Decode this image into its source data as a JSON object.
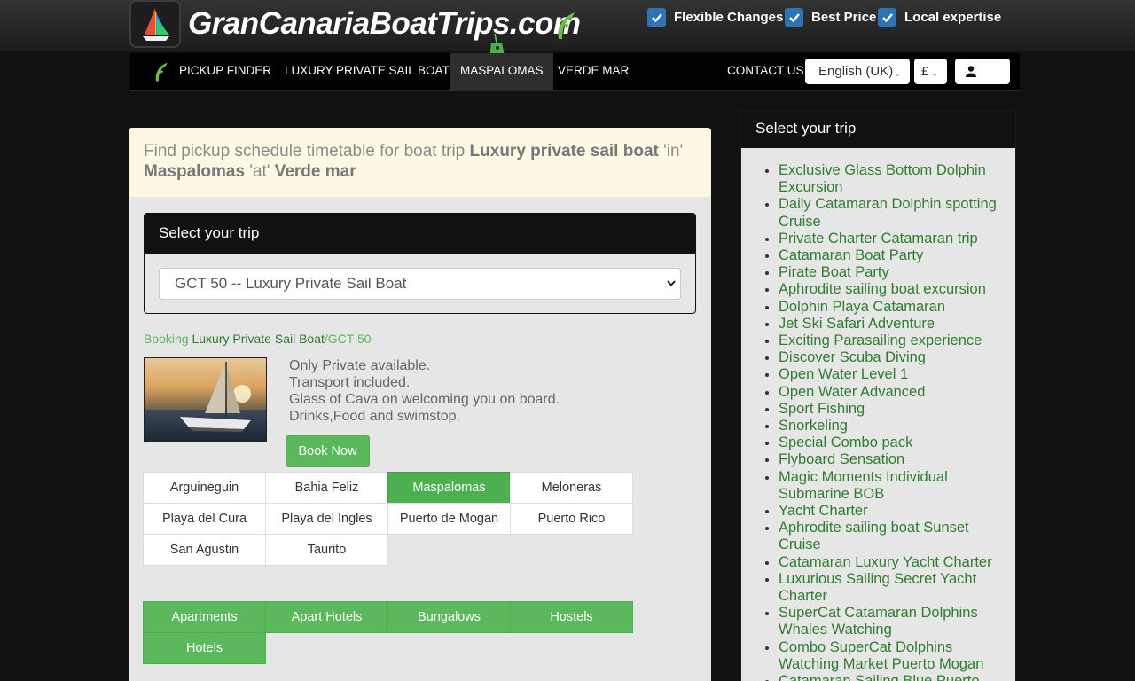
{
  "header": {
    "logo_text": "GranCanariaBoatTrips.com",
    "features": [
      {
        "label": "Flexible Changes",
        "checked": true
      },
      {
        "label": "Best Price",
        "checked": true
      },
      {
        "label": "Local expertise",
        "checked": true
      }
    ]
  },
  "nav": {
    "items": [
      "PICKUP FINDER",
      "LUXURY PRIVATE SAIL BOAT",
      "MASPALOMAS",
      "VERDE MAR"
    ],
    "active": "MASPALOMAS",
    "contact": "CONTACT US",
    "language": "English (UK)",
    "currency": "£"
  },
  "alert": {
    "prefix": "Find pickup schedule timetable for boat trip",
    "trip": "Luxury private sail boat",
    "in_text": "'in'",
    "location": "Maspalomas",
    "at_text": "'at'",
    "hotel": "Verde mar"
  },
  "trip_panel": {
    "title": "Select your trip",
    "selected": "GCT 50 -- Luxury Private Sail Boat"
  },
  "breadcrumb": {
    "booking": "Booking",
    "trip": "Luxury Private Sail Boat",
    "sep_code": "/GCT 50"
  },
  "description": [
    "Only Private available.",
    "Transport included.",
    "Glass of Cava on welcoming you on board.",
    "Drinks,Food and swimstop."
  ],
  "book_button": "Book Now",
  "locations": [
    "Arguineguin",
    "Bahia Feliz",
    "Maspalomas",
    "Meloneras",
    "Playa del Cura",
    "Playa del Ingles",
    "Puerto de Mogan",
    "Puerto Rico",
    "San Agustin",
    "Taurito"
  ],
  "active_location": "Maspalomas",
  "accommodations": [
    "Apartments",
    "Apart Hotels",
    "Bungalows",
    "Hostels",
    "Hotels"
  ],
  "sidebar": {
    "title": "Select your trip",
    "trips": [
      "Exclusive Glass Bottom Dolphin Excursion",
      "Daily Catamaran Dolphin spotting Cruise",
      "Private Charter Catamaran trip",
      "Catamaran Boat Party",
      "Pirate Boat Party",
      "Aphrodite sailing boat excursion",
      "Dolphin Playa Catamaran",
      "Jet Ski Safari Adventure",
      "Exciting Parasailing experience",
      "Discover Scuba Diving",
      "Open Water Level 1",
      "Open Water Advanced",
      "Sport Fishing",
      "Snorkeling",
      "Special Combo pack",
      "Flyboard Sensation",
      "Magic Moments Individual Submarine BOB",
      "Yacht Charter",
      "Aphrodite sailing boat Sunset Cruise",
      "Catamaran Luxury Yacht Charter",
      "Luxurious Sailing Secret Yacht Charter",
      "SuperCat Catamaran Dolphins Whales Watching",
      "Combo SuperCat Dolphins Watching Market Puerto Mogan",
      "Catamaran Sailing Blue Puerto"
    ]
  },
  "colors": {
    "accent_green": "#5cb85c",
    "link_green": "#2f7d2f",
    "checkbox_blue": "#2f73b7",
    "alert_bg": "#fcf8e3"
  }
}
